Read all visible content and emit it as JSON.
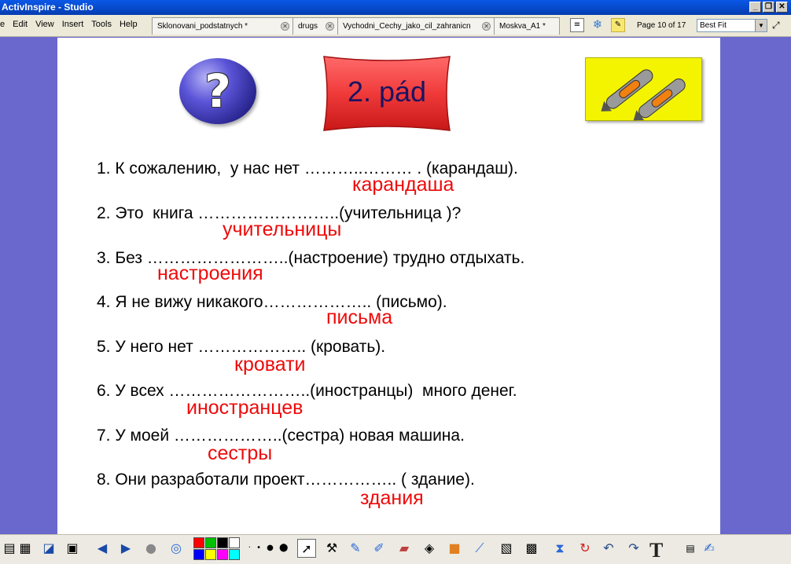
{
  "window": {
    "title": "ActivInspire - Studio"
  },
  "menu": [
    "e",
    "Edit",
    "View",
    "Insert",
    "Tools",
    "Help"
  ],
  "tabs": [
    {
      "label": "Sklonovani_podstatnych *"
    },
    {
      "label": "drugs"
    },
    {
      "label": "Vychodni_Cechy_jako_cil_zahranicn"
    },
    {
      "label": "Moskva_A1 *"
    }
  ],
  "page_indicator": "Page 10 of 17",
  "zoom": {
    "selected": "Best Fit"
  },
  "slide": {
    "heading": "2. pád",
    "question_mark": "?",
    "exercises": [
      {
        "text": "1. К сожалению,  у нас нет ………..……… . (карандаш).",
        "answer": "карандаша"
      },
      {
        "text": "2. Это  книга ……………………..(учительница )?",
        "answer": "учительницы"
      },
      {
        "text": "3. Без ……………………..(настроение) трудно отдыхать.",
        "answer": "настроения"
      },
      {
        "text": "4. Я не вижу никакого……………….. (письмо).",
        "answer": "письма"
      },
      {
        "text": "5. У него нет ……………….. (кровать).",
        "answer": "кровати"
      },
      {
        "text": "6. У всех ……………………..(иностранцы)  много денег.",
        "answer": "иностранцев"
      },
      {
        "text": "7. У моей ………………..(сестра) новая машина.",
        "answer": "сестры"
      },
      {
        "text": "8. Они разработали проект…………….. ( здание).",
        "answer": "здания"
      }
    ]
  },
  "colors": {
    "answer_red": "#ee0a0a",
    "background_purple": "#6a68cc",
    "banner_red": "#f03a3a",
    "pens_yellow": "#f4f400"
  }
}
